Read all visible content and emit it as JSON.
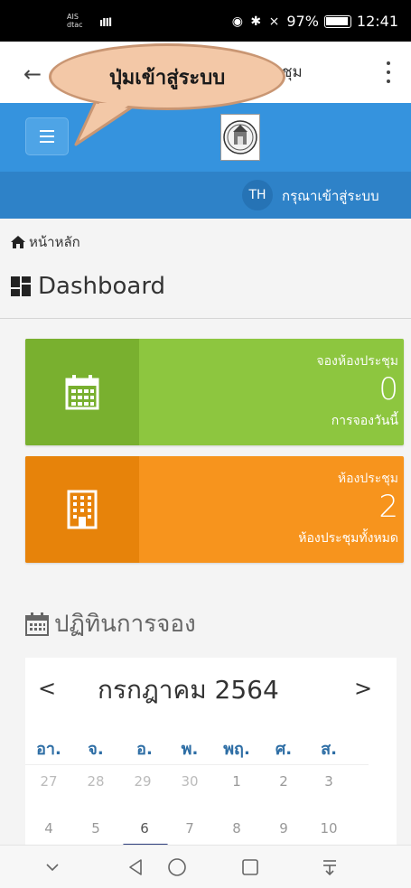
{
  "status_bar": {
    "carrier_line1": "AIS",
    "carrier_line2": "dtac",
    "signal": "4G",
    "icons": "◉ ✱ ⨯",
    "battery": "97%",
    "time": "12:41"
  },
  "app_bar": {
    "title_fragment": "ชุม"
  },
  "callout": {
    "text": "ปุ่มเข้าสู่ระบบ"
  },
  "header": {
    "lang": "TH",
    "login_label": "กรุณาเข้าสู่ระบบ"
  },
  "breadcrumb": {
    "home_label": "หน้าหลัก"
  },
  "page_title": "Dashboard",
  "cards": [
    {
      "title": "จองห้องประชุม",
      "value": "0",
      "subtitle": "การจองวันนี้",
      "color": "#8dc63f",
      "icon": "calendar-icon"
    },
    {
      "title": "ห้องประชุม",
      "value": "2",
      "subtitle": "ห้องประชุมทั้งหมด",
      "color": "#f7941d",
      "icon": "building-icon"
    }
  ],
  "calendar": {
    "heading": "ปฏิทินการจอง",
    "prev": "<",
    "next": ">",
    "month_label": "กรกฎาคม 2564",
    "weekdays": [
      "อา.",
      "จ.",
      "อ.",
      "พ.",
      "พฤ.",
      "ศ.",
      "ส."
    ],
    "week1": [
      "27",
      "28",
      "29",
      "30",
      "1",
      "2",
      "3"
    ],
    "week2": [
      "4",
      "5",
      "6",
      "7",
      "8",
      "9",
      "10"
    ],
    "today": "6"
  },
  "colors": {
    "header_blue": "#3593de",
    "header_blue_dark": "#2e82c8",
    "card_green": "#8dc63f",
    "card_orange": "#f7941d",
    "weekday_blue": "#2e6ea5"
  }
}
